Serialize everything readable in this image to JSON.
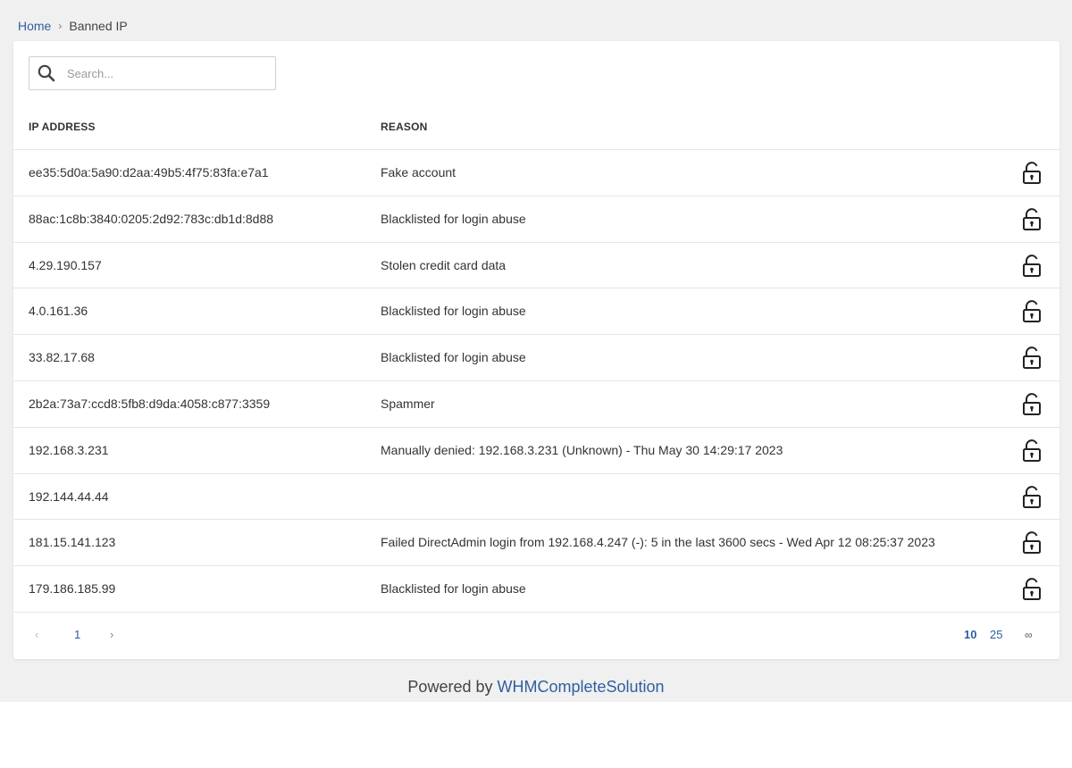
{
  "breadcrumb": {
    "home": "Home",
    "separator": "›",
    "current": "Banned IP"
  },
  "search": {
    "placeholder": "Search...",
    "value": ""
  },
  "table": {
    "headers": {
      "ip": "IP ADDRESS",
      "reason": "REASON"
    },
    "rows": [
      {
        "ip": "ee35:5d0a:5a90:d2aa:49b5:4f75:83fa:e7a1",
        "reason": "Fake account"
      },
      {
        "ip": "88ac:1c8b:3840:0205:2d92:783c:db1d:8d88",
        "reason": "Blacklisted for login abuse"
      },
      {
        "ip": "4.29.190.157",
        "reason": "Stolen credit card data"
      },
      {
        "ip": "4.0.161.36",
        "reason": "Blacklisted for login abuse"
      },
      {
        "ip": "33.82.17.68",
        "reason": "Blacklisted for login abuse"
      },
      {
        "ip": "2b2a:73a7:ccd8:5fb8:d9da:4058:c877:3359",
        "reason": "Spammer"
      },
      {
        "ip": "192.168.3.231",
        "reason": "Manually denied: 192.168.3.231 (Unknown) - Thu May 30 14:29:17 2023"
      },
      {
        "ip": "192.144.44.44",
        "reason": ""
      },
      {
        "ip": "181.15.141.123",
        "reason": "Failed DirectAdmin login from 192.168.4.247 (-): 5 in the last 3600 secs - Wed Apr 12 08:25:37 2023"
      },
      {
        "ip": "179.186.185.99",
        "reason": "Blacklisted for login abuse"
      }
    ],
    "row_action_icon": "unlock-icon"
  },
  "pagination": {
    "prev": "‹",
    "current_page": "1",
    "next": "›",
    "page_sizes": [
      "10",
      "25",
      "∞"
    ]
  },
  "footer": {
    "prefix": "Powered by ",
    "link": "WHMCompleteSolution"
  },
  "colors": {
    "accent": "#2e5fa1",
    "page_bg": "#f0f0f0",
    "border": "#e6e6e6"
  }
}
